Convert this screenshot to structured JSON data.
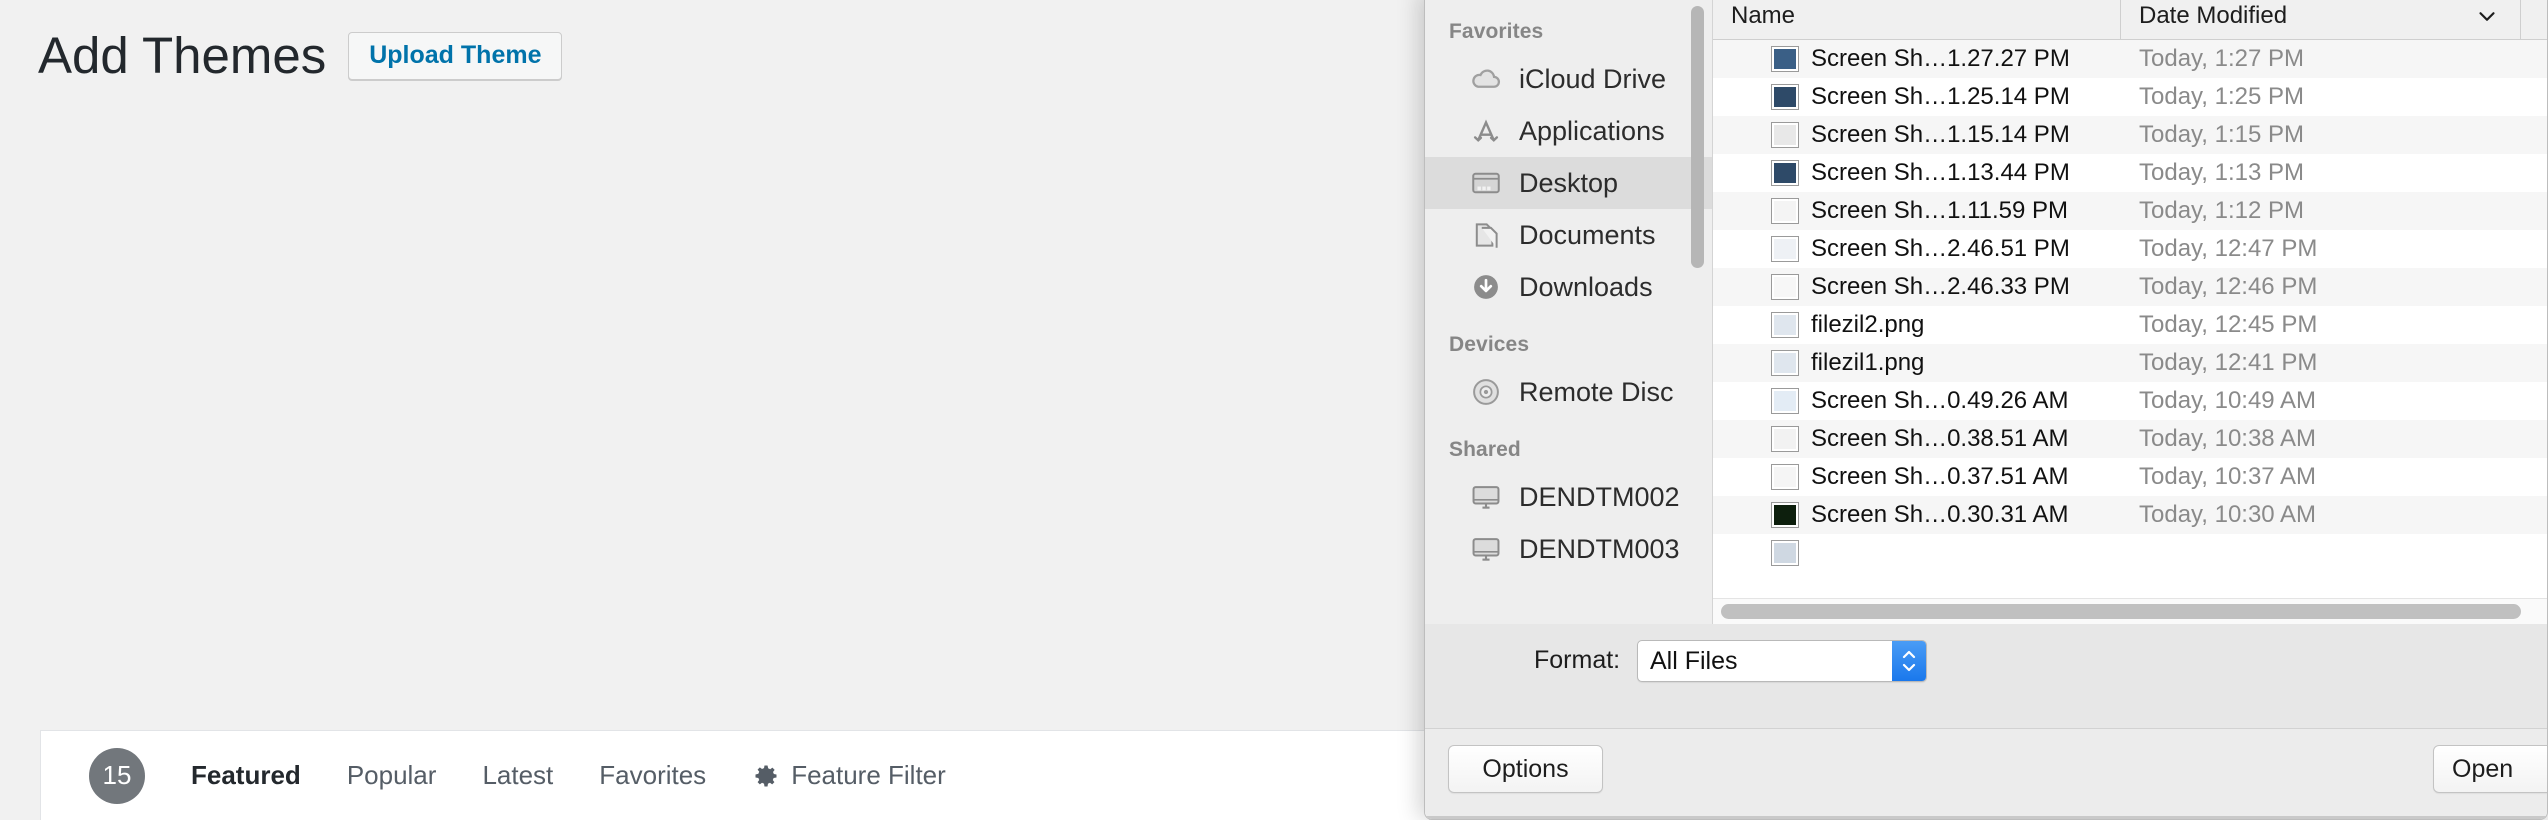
{
  "wp": {
    "page_title": "Add Themes",
    "upload_button": "Upload Theme",
    "filter_bar": {
      "count": "15",
      "tabs": [
        {
          "label": "Featured",
          "active": true
        },
        {
          "label": "Popular",
          "active": false
        },
        {
          "label": "Latest",
          "active": false
        },
        {
          "label": "Favorites",
          "active": false
        }
      ],
      "feature_filter": "Feature Filter",
      "feature_filter_icon": "gear-icon"
    },
    "accent_color": "#0073aa",
    "background_color": "#f1f1f1"
  },
  "file_dialog": {
    "sidebar": {
      "sections": [
        {
          "title": "Favorites",
          "items": [
            {
              "label": "iCloud Drive",
              "icon": "cloud-icon",
              "selected": false
            },
            {
              "label": "Applications",
              "icon": "applications-icon",
              "selected": false
            },
            {
              "label": "Desktop",
              "icon": "desktop-icon",
              "selected": true
            },
            {
              "label": "Documents",
              "icon": "documents-icon",
              "selected": false
            },
            {
              "label": "Downloads",
              "icon": "downloads-icon",
              "selected": false
            }
          ]
        },
        {
          "title": "Devices",
          "items": [
            {
              "label": "Remote Disc",
              "icon": "disc-icon",
              "selected": false
            }
          ]
        },
        {
          "title": "Shared",
          "items": [
            {
              "label": "DENDTM002",
              "icon": "display-icon",
              "selected": false
            },
            {
              "label": "DENDTM003",
              "icon": "display-icon",
              "selected": false
            }
          ]
        }
      ]
    },
    "file_list": {
      "columns": [
        "Name",
        "Date Modified"
      ],
      "sort_icon": "chevron-down-icon",
      "rows": [
        {
          "name": "Screen Sh…1.27.27 PM",
          "date": "Today, 1:27 PM",
          "thumb": "#3a5f86"
        },
        {
          "name": "Screen Sh…1.25.14 PM",
          "date": "Today, 1:25 PM",
          "thumb": "#2e4a68"
        },
        {
          "name": "Screen Sh…1.15.14 PM",
          "date": "Today, 1:15 PM",
          "thumb": "#e8e8e8"
        },
        {
          "name": "Screen Sh…1.13.44 PM",
          "date": "Today, 1:13 PM",
          "thumb": "#2e4a68"
        },
        {
          "name": "Screen Sh…1.11.59 PM",
          "date": "Today, 1:12 PM",
          "thumb": "#f4f4f4"
        },
        {
          "name": "Screen Sh…2.46.51 PM",
          "date": "Today, 12:47 PM",
          "thumb": "#eef1f5"
        },
        {
          "name": "Screen Sh…2.46.33 PM",
          "date": "Today, 12:46 PM",
          "thumb": "#f7f7f7"
        },
        {
          "name": "filezil2.png",
          "date": "Today, 12:45 PM",
          "thumb": "#dfe6ee"
        },
        {
          "name": "filezil1.png",
          "date": "Today, 12:41 PM",
          "thumb": "#dfe6ee"
        },
        {
          "name": "Screen Sh…0.49.26 AM",
          "date": "Today, 10:49 AM",
          "thumb": "#e3ecf5"
        },
        {
          "name": "Screen Sh…0.38.51 AM",
          "date": "Today, 10:38 AM",
          "thumb": "#f2f2f2"
        },
        {
          "name": "Screen Sh…0.37.51 AM",
          "date": "Today, 10:37 AM",
          "thumb": "#f5f5f5"
        },
        {
          "name": "Screen Sh…0.30.31 AM",
          "date": "Today, 10:30 AM",
          "thumb": "#0d1f0d"
        },
        {
          "name": "",
          "date": "",
          "thumb": "#cfd8e2"
        }
      ]
    },
    "format": {
      "label": "Format:",
      "value": "All Files"
    },
    "buttons": {
      "options": "Options",
      "open": "Open"
    }
  }
}
